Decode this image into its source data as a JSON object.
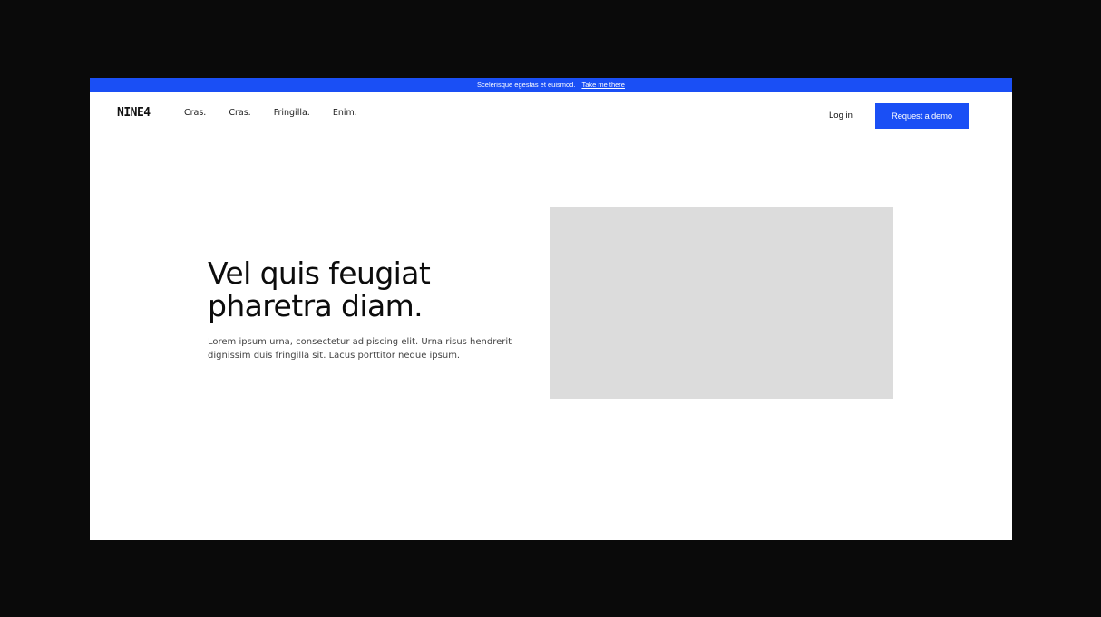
{
  "announcement": {
    "text": "Scelerisque egestas et euismod.",
    "link_label": "Take me there"
  },
  "header": {
    "logo": "NINE4",
    "nav": [
      "Cras.",
      "Cras.",
      "Fringilla.",
      "Enim."
    ],
    "login_label": "Log in",
    "cta_label": "Request a demo"
  },
  "hero": {
    "title": "Vel quis feugiat pharetra diam.",
    "subtitle": "Lorem ipsum urna, consectetur adipiscing elit. Urna risus hendrerit dignissim duis fringilla sit. Lacus porttitor neque ipsum."
  },
  "colors": {
    "accent": "#1a4ff5",
    "image_placeholder": "#dcdcdc",
    "backdrop": "#0a0a0a"
  }
}
